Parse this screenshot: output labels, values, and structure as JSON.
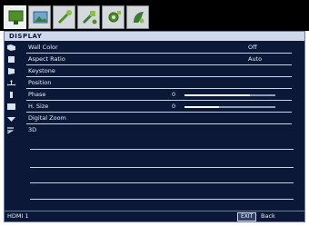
{
  "tabs": [
    {
      "name": "display",
      "active": true
    },
    {
      "name": "picture",
      "active": false
    },
    {
      "name": "setup-basic",
      "active": false
    },
    {
      "name": "setup-advanced",
      "active": false
    },
    {
      "name": "system-setup",
      "active": false
    },
    {
      "name": "information",
      "active": false
    }
  ],
  "menu": {
    "title": "DISPLAY",
    "rows": [
      {
        "label": "Wall Color",
        "value": "Off"
      },
      {
        "label": "Aspect Ratio",
        "value": "Auto"
      },
      {
        "label": "Keystone",
        "value": ""
      },
      {
        "label": "Position",
        "value": ""
      },
      {
        "label": "Phase",
        "value": "0"
      },
      {
        "label": "H. Size",
        "value": "0"
      },
      {
        "label": "Digital Zoom",
        "value": ""
      },
      {
        "label": "3D",
        "value": ""
      }
    ],
    "sliders": {
      "phase_level": 0.72,
      "hsize_level": 0.38
    }
  },
  "status": {
    "source": "HDMI 1",
    "exit_button": "EXIT",
    "exit_text": "Back"
  }
}
